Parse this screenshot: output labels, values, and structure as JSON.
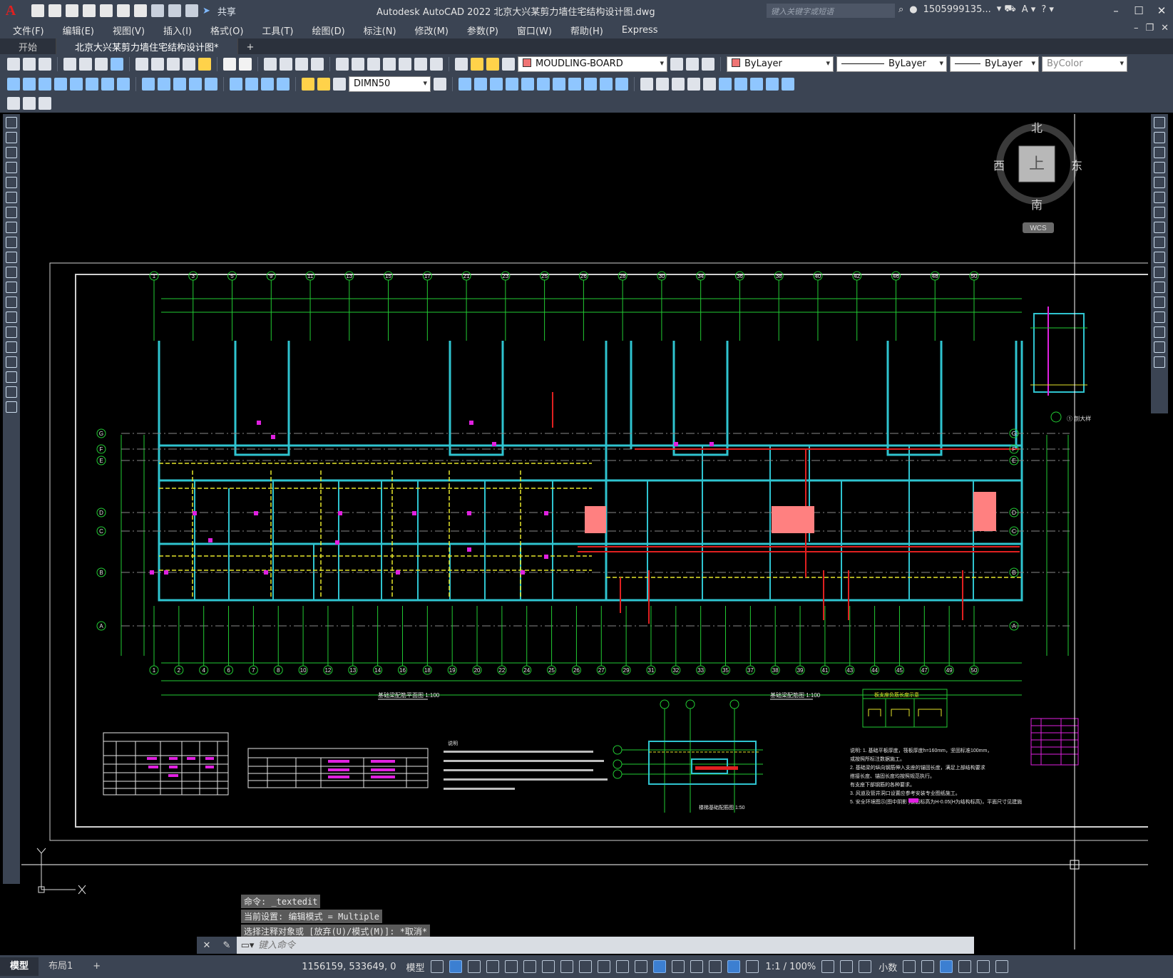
{
  "app": {
    "logo": "A",
    "share_label": "共享",
    "title": "Autodesk AutoCAD 2022    北京大兴某剪力墙住宅结构设计图.dwg",
    "search_placeholder": "键入关键字或短语",
    "user": "1505999135...",
    "window_controls": [
      "minimize-icon",
      "restore-icon",
      "close-icon"
    ]
  },
  "menu": [
    "文件(F)",
    "编辑(E)",
    "视图(V)",
    "插入(I)",
    "格式(O)",
    "工具(T)",
    "绘图(D)",
    "标注(N)",
    "修改(M)",
    "参数(P)",
    "窗口(W)",
    "帮助(H)",
    "Express"
  ],
  "tabs": [
    {
      "label": "开始",
      "active": false
    },
    {
      "label": "北京大兴某剪力墙住宅结构设计图*",
      "active": true
    }
  ],
  "toolbar": {
    "layer": "MOUDLING-BOARD",
    "color": "ByLayer",
    "linetype": "ByLayer",
    "lineweight": "ByLayer",
    "plotstyle": "ByColor",
    "dimstyle": "DIMN50"
  },
  "viewcube": {
    "north": "北",
    "south": "南",
    "east": "东",
    "west": "西",
    "top": "上",
    "wcs": "WCS"
  },
  "drawing": {
    "axis_top": [
      "1",
      "3",
      "5",
      "9",
      "11",
      "13",
      "15",
      "17",
      "21",
      "23",
      "25",
      "26",
      "28",
      "30",
      "34",
      "36",
      "38",
      "40",
      "42",
      "46",
      "48",
      "50"
    ],
    "axis_bottom": [
      "1",
      "2",
      "4",
      "6",
      "7",
      "8",
      "10",
      "12",
      "13",
      "14",
      "16",
      "18",
      "19",
      "20",
      "22",
      "24",
      "25",
      "26",
      "27",
      "29",
      "31",
      "32",
      "33",
      "35",
      "37",
      "38",
      "39",
      "41",
      "43",
      "44",
      "45",
      "47",
      "49",
      "50"
    ],
    "axis_rows": [
      "G",
      "F",
      "E",
      "D",
      "C",
      "B",
      "A"
    ],
    "title_plan_left": "基础梁配筋平面图  1:100",
    "title_plan_right": "基础梁配筋图  1:100",
    "title_detail": "楼梯基础配筋图  1:50",
    "title_legend": "板支座负筋长度示意",
    "title_side": "① 剖大样",
    "notes_heading": "说明",
    "notes_right": [
      "说明: 1. 基础平板厚度，筏板厚度h=160mm，坚固标准100mm，",
      "      或按照所标注数据施工。",
      "2. 基础梁的纵向钢筋伸入支座的锚固长度，满足上部结构要求",
      "   搭接长度、锚固长度均按照规范执行。",
      "   有支座下部钢筋的各种要求。",
      "3. 风道及管井洞口设置应参考安装专业图纸施工。",
      "5. 安全环境图示(图中阴影     )板面标高为H-0.05(H为结构标高)，平面尺寸见建施"
    ]
  },
  "command": {
    "history": [
      "命令: _textedit",
      "当前设置: 编辑模式 = Multiple",
      "选择注释对象或 [放弃(U)/模式(M)]: *取消*"
    ],
    "placeholder": "键入命令"
  },
  "status": {
    "layout_tabs": [
      {
        "label": "模型",
        "active": true
      },
      {
        "label": "布局1",
        "active": false
      }
    ],
    "coords": "1156159, 533649, 0",
    "space": "模型",
    "scale": "1:1 / 100%",
    "units": "小数"
  }
}
